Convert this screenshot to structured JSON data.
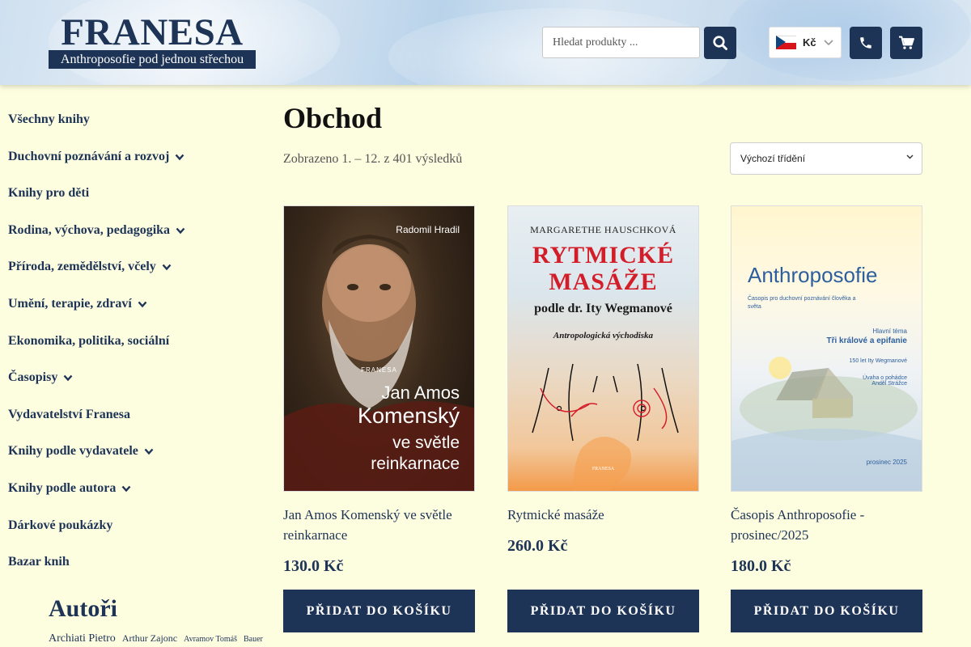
{
  "header": {
    "logo": {
      "name": "FRANESA",
      "tagline": "Anthroposofie pod jednou střechou"
    },
    "search_placeholder": "Hledat produkty ...",
    "currency": "Kč",
    "icons": {
      "search": "search-icon",
      "phone": "phone-icon",
      "cart": "cart-icon"
    }
  },
  "sidebar": {
    "items": [
      {
        "label": "Všechny knihy",
        "has_children": false
      },
      {
        "label": "Duchovní poznávání a rozvoj",
        "has_children": true
      },
      {
        "label": "Knihy pro děti",
        "has_children": false
      },
      {
        "label": "Rodina, výchova, pedagogika",
        "has_children": true
      },
      {
        "label": "Příroda, zemědělství, včely",
        "has_children": true
      },
      {
        "label": "Umění, terapie, zdraví",
        "has_children": true
      },
      {
        "label": "Ekonomika, politika, sociální",
        "has_children": false
      },
      {
        "label": "Časopisy",
        "has_children": true
      },
      {
        "label": "Vydavatelství Franesa",
        "has_children": false
      },
      {
        "label": "Knihy podle vydavatele",
        "has_children": true
      },
      {
        "label": "Knihy podle autora",
        "has_children": true
      },
      {
        "label": "Dárkové poukázky",
        "has_children": false
      },
      {
        "label": "Bazar knih",
        "has_children": false
      }
    ],
    "authors_title": "Autoři",
    "author_tags": [
      {
        "label": "Archiati Pietro",
        "size": "large"
      },
      {
        "label": "Arthur Zajonc",
        "size": "medium"
      },
      {
        "label": "Avramov Tomáš",
        "size": "small"
      },
      {
        "label": "Bauer",
        "size": "small"
      }
    ]
  },
  "main": {
    "title": "Obchod",
    "results": "Zobrazeno 1. – 12. z 401 výsledků",
    "sort_selected": "Výchozí třídění",
    "add_to_cart_label": "Přidat do košíku",
    "products": [
      {
        "name": "Jan Amos Komenský ve světle reinkarnace",
        "price": "130.0 Kč",
        "cover": {
          "author": "Radomil Hradil",
          "publisher": "FRANESA",
          "line1": "Jan Amos",
          "line2": "Komenský",
          "line3": "ve světle reinkarnace"
        }
      },
      {
        "name": "Rytmické masáže",
        "price": "260.0 Kč",
        "cover": {
          "author": "MARGARETHE HAUSCHKOVÁ",
          "title_line1": "RYTMICKÉ",
          "title_line2": "MASÁŽE",
          "subtitle": "podle dr. Ity Wegmanové",
          "subtitle2": "Antropologická východiska",
          "publisher": "FRANESA"
        }
      },
      {
        "name": "Časopis Anthroposofie - prosinec/2025",
        "price": "180.0 Kč",
        "cover": {
          "title": "Anthroposofie",
          "subtitle": "Časopis pro duchovní poznávání člověka a světa",
          "theme_label": "Hlavní téma",
          "theme": "Tři králové a epifanie",
          "note1": "150 let Ity Wegmanové",
          "note2": "Úvaha o pohádce",
          "note3": "Anděl Strážce",
          "date": "prosinec 2025"
        }
      }
    ]
  },
  "colors": {
    "brand_navy": "#1e3456",
    "page_bg": "#fdfde0",
    "cover_red": "#d31e2a"
  }
}
